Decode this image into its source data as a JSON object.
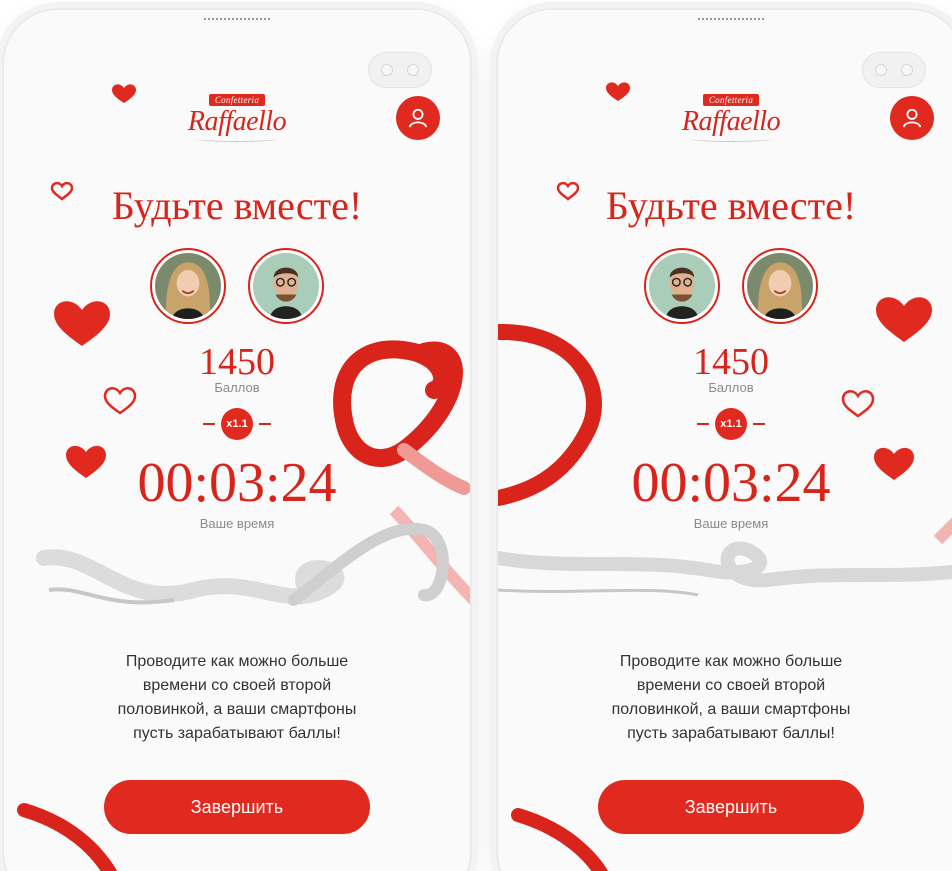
{
  "screens": [
    {
      "brand": {
        "sub": "Confetteria",
        "name": "Raffaello"
      },
      "title": "Будьте вместе!",
      "score": "1450",
      "score_label": "Баллов",
      "multiplier": "x1.1",
      "timer": "00:03:24",
      "timer_label": "Ваше время",
      "description": "Проводите как можно больше времени со своей второй половинкой, а ваши смартфоны пусть зарабатывают баллы!",
      "finish_button": "Завершить",
      "avatars": [
        "woman-avatar",
        "man-avatar"
      ]
    },
    {
      "brand": {
        "sub": "Confetteria",
        "name": "Raffaello"
      },
      "title": "Будьте вместе!",
      "score": "1450",
      "score_label": "Баллов",
      "multiplier": "x1.1",
      "timer": "00:03:24",
      "timer_label": "Ваше время",
      "description": "Проводите как можно больше времени со своей второй половинкой, а ваши смартфоны пусть зарабатывают баллы!",
      "finish_button": "Завершить",
      "avatars": [
        "man-avatar",
        "woman-avatar"
      ]
    }
  ],
  "colors": {
    "accent": "#e12a1f",
    "text_red": "#d8241b",
    "muted": "#8a8a8a",
    "body_text": "#333333"
  },
  "icons": {
    "profile": "user-icon",
    "heart": "heart-icon",
    "heart_outline": "heart-outline-icon",
    "ribbon": "ribbon-decoration"
  }
}
